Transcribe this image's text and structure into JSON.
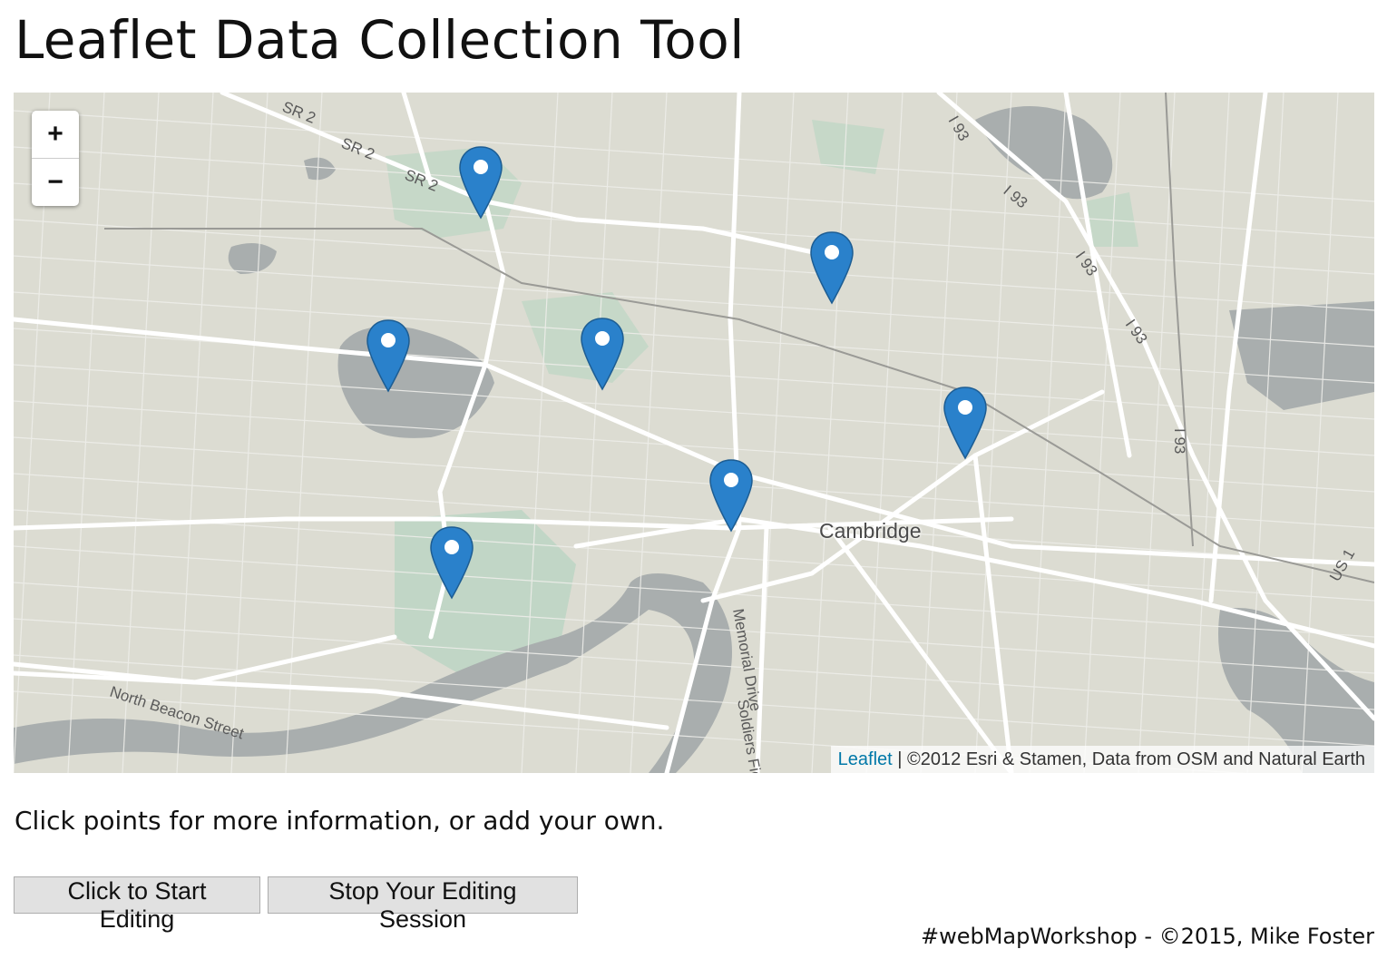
{
  "page": {
    "title": "Leaflet Data Collection Tool",
    "instructions": "Click points for more information, or add your own.",
    "footer": "#webMapWorkshop - ©2015, Mike Foster"
  },
  "map": {
    "zoom_in_label": "+",
    "zoom_out_label": "−",
    "city_label": "Cambridge",
    "attribution_link": "Leaflet",
    "attribution_text": " | ©2012 Esri & Stamen, Data from OSM and Natural Earth",
    "road_labels": [
      "SR 2",
      "SR 2",
      "SR 2",
      "I 93",
      "I 93",
      "I 93",
      "I 93",
      "US 1",
      "Memorial Drive",
      "Soldiers Field",
      "North Beacon Street"
    ],
    "marker_icon": "map-pin-icon",
    "marker_color": "#2a81cb",
    "marker_count": 7
  },
  "buttons": {
    "start_label": "Click to Start Editing",
    "stop_label": "Stop Your Editing Session"
  }
}
